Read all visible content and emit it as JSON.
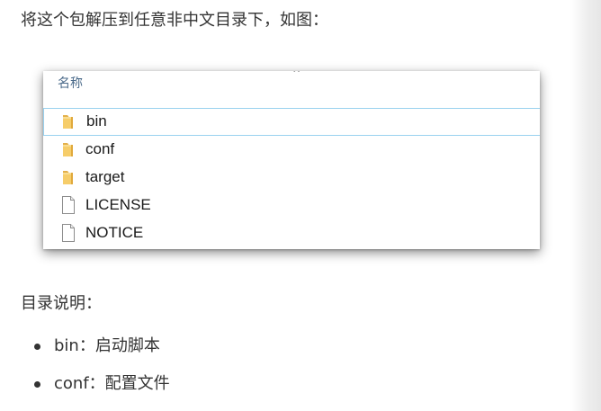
{
  "article": {
    "intro": "将这个包解压到任意非中文目录下，如图：",
    "dir_heading": "目录说明：",
    "bullets": [
      {
        "text": "bin：启动脚本"
      },
      {
        "text": "conf：配置文件"
      }
    ]
  },
  "explorer": {
    "sort_indicator": "^",
    "column_header": "名称",
    "items": [
      {
        "name": "bin",
        "type": "folder",
        "icon": "folder-icon",
        "selected": true
      },
      {
        "name": "conf",
        "type": "folder",
        "icon": "folder-icon",
        "selected": false
      },
      {
        "name": "target",
        "type": "folder",
        "icon": "folder-icon",
        "selected": false
      },
      {
        "name": "LICENSE",
        "type": "file",
        "icon": "file-icon",
        "selected": false
      },
      {
        "name": "NOTICE",
        "type": "file",
        "icon": "file-icon",
        "selected": false
      }
    ]
  },
  "colors": {
    "text": "#333333",
    "header_text": "#4a6a8a",
    "selection_border": "#99d1ef",
    "folder": "#f0c35c"
  }
}
